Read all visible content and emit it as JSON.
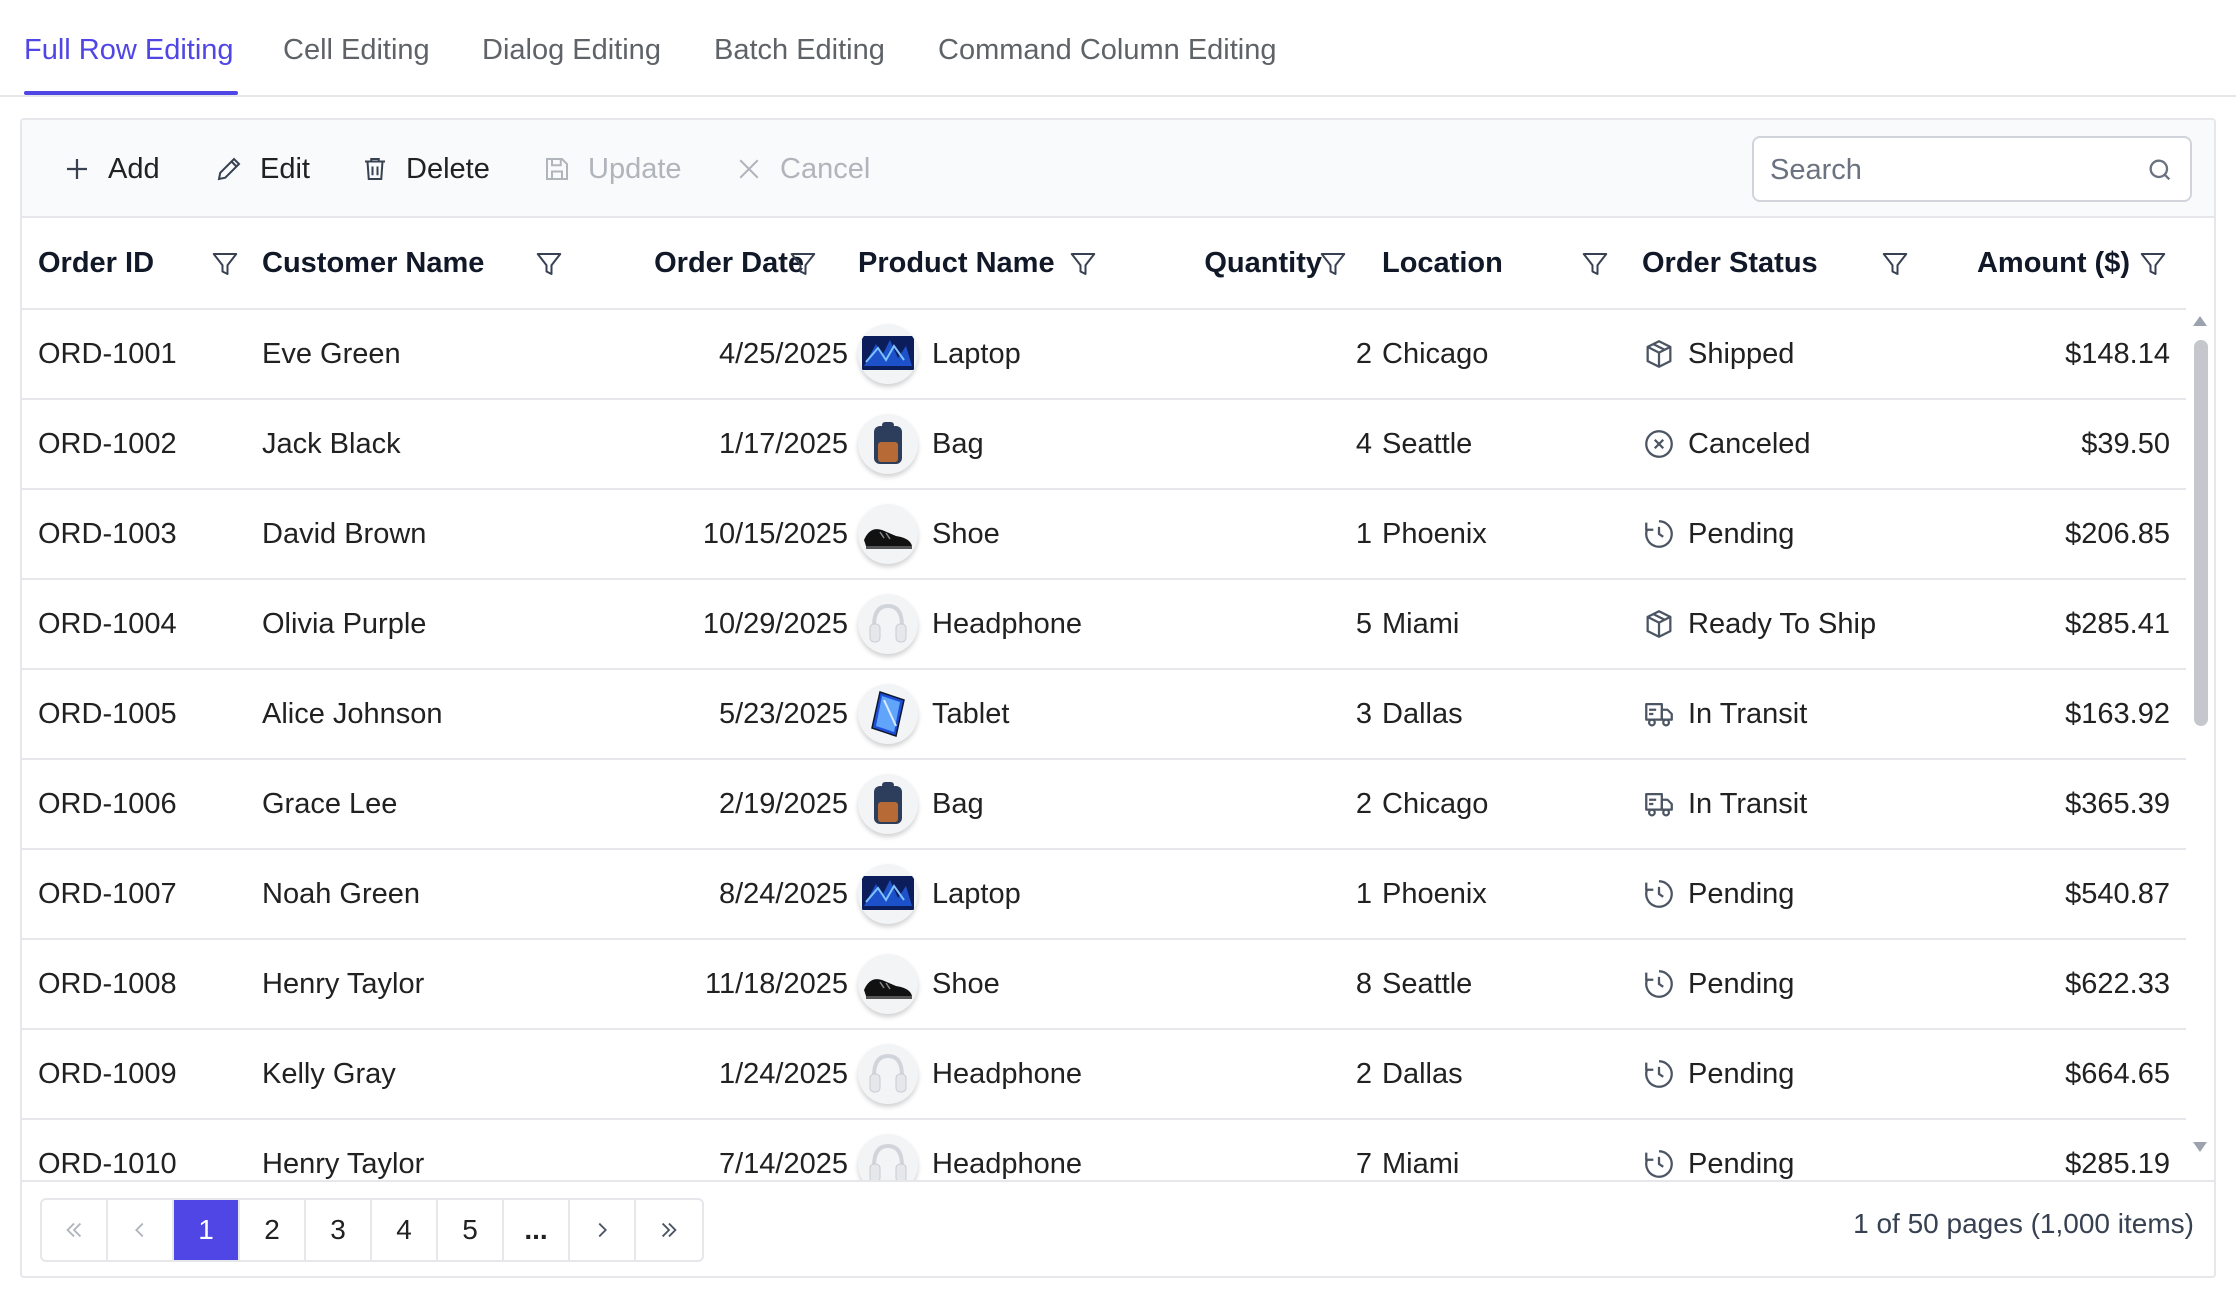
{
  "tabs": [
    "Full Row Editing",
    "Cell Editing",
    "Dialog Editing",
    "Batch Editing",
    "Command Column Editing"
  ],
  "active_tab": "Full Row Editing",
  "accent_color": "#4f46e5",
  "toolbar": {
    "add_label": "Add",
    "edit_label": "Edit",
    "delete_label": "Delete",
    "update_label": "Update",
    "cancel_label": "Cancel",
    "search_placeholder": "Search"
  },
  "columns": [
    "Order ID",
    "Customer Name",
    "Order Date",
    "Product Name",
    "Quantity",
    "Location",
    "Order Status",
    "Amount ($)"
  ],
  "rows": [
    {
      "order_id": "ORD-1001",
      "customer": "Eve Green",
      "date": "4/25/2025",
      "product": "Laptop",
      "product_icon": "laptop-image",
      "quantity": "2",
      "location": "Chicago",
      "status": "Shipped",
      "status_icon": "package-icon",
      "amount": "$148.14"
    },
    {
      "order_id": "ORD-1002",
      "customer": "Jack Black",
      "date": "1/17/2025",
      "product": "Bag",
      "product_icon": "bag-image",
      "quantity": "4",
      "location": "Seattle",
      "status": "Canceled",
      "status_icon": "circle-x-icon",
      "amount": "$39.50"
    },
    {
      "order_id": "ORD-1003",
      "customer": "David Brown",
      "date": "10/15/2025",
      "product": "Shoe",
      "product_icon": "shoe-image",
      "quantity": "1",
      "location": "Phoenix",
      "status": "Pending",
      "status_icon": "clock-icon",
      "amount": "$206.85"
    },
    {
      "order_id": "ORD-1004",
      "customer": "Olivia Purple",
      "date": "10/29/2025",
      "product": "Headphone",
      "product_icon": "headphone-image",
      "quantity": "5",
      "location": "Miami",
      "status": "Ready To Ship",
      "status_icon": "package-icon",
      "amount": "$285.41"
    },
    {
      "order_id": "ORD-1005",
      "customer": "Alice Johnson",
      "date": "5/23/2025",
      "product": "Tablet",
      "product_icon": "tablet-image",
      "quantity": "3",
      "location": "Dallas",
      "status": "In Transit",
      "status_icon": "truck-icon",
      "amount": "$163.92"
    },
    {
      "order_id": "ORD-1006",
      "customer": "Grace Lee",
      "date": "2/19/2025",
      "product": "Bag",
      "product_icon": "bag-image",
      "quantity": "2",
      "location": "Chicago",
      "status": "In Transit",
      "status_icon": "truck-icon",
      "amount": "$365.39"
    },
    {
      "order_id": "ORD-1007",
      "customer": "Noah Green",
      "date": "8/24/2025",
      "product": "Laptop",
      "product_icon": "laptop-image",
      "quantity": "1",
      "location": "Phoenix",
      "status": "Pending",
      "status_icon": "clock-icon",
      "amount": "$540.87"
    },
    {
      "order_id": "ORD-1008",
      "customer": "Henry Taylor",
      "date": "11/18/2025",
      "product": "Shoe",
      "product_icon": "shoe-image",
      "quantity": "8",
      "location": "Seattle",
      "status": "Pending",
      "status_icon": "clock-icon",
      "amount": "$622.33"
    },
    {
      "order_id": "ORD-1009",
      "customer": "Kelly Gray",
      "date": "1/24/2025",
      "product": "Headphone",
      "product_icon": "headphone-image",
      "quantity": "2",
      "location": "Dallas",
      "status": "Pending",
      "status_icon": "clock-icon",
      "amount": "$664.65"
    },
    {
      "order_id": "ORD-1010",
      "customer": "Henry Taylor",
      "date": "7/14/2025",
      "product": "Headphone",
      "product_icon": "headphone-image",
      "quantity": "7",
      "location": "Miami",
      "status": "Pending",
      "status_icon": "clock-icon",
      "amount": "$285.19"
    }
  ],
  "pager": {
    "pages": [
      "1",
      "2",
      "3",
      "4",
      "5"
    ],
    "current": "1",
    "ellipsis": "...",
    "info": "1 of 50 pages (1,000 items)"
  }
}
